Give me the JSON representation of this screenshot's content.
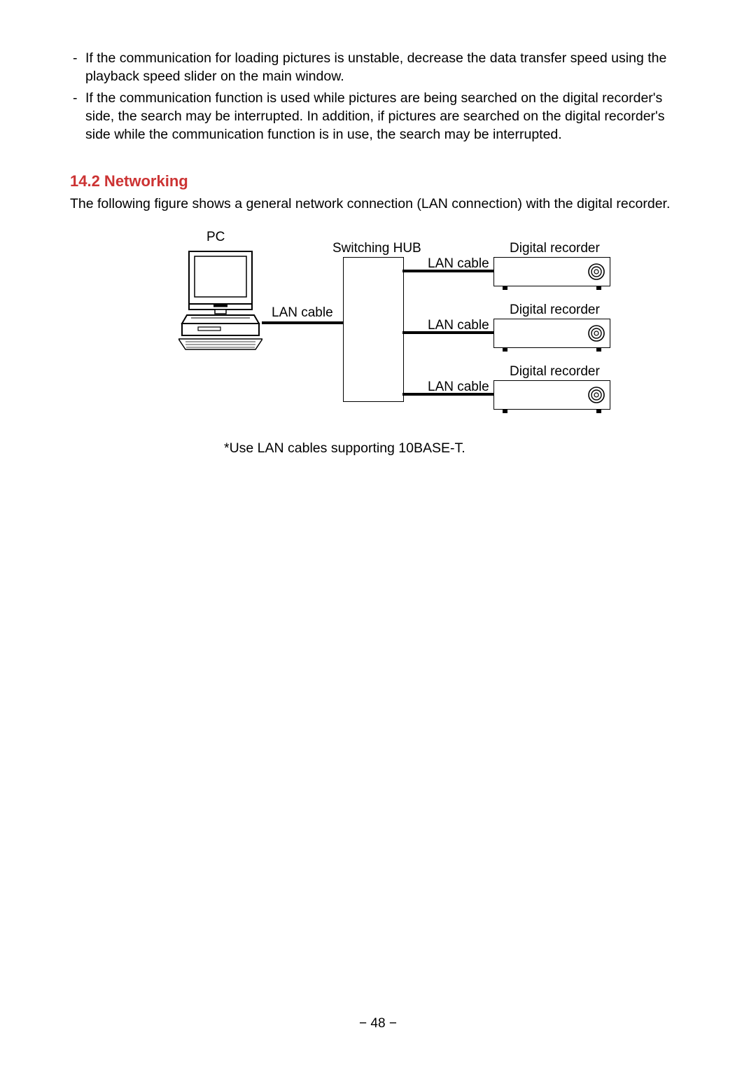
{
  "bullets": [
    "If the communication for loading pictures is unstable, decrease the data transfer speed using the playback speed slider on the main window.",
    "If the communication function is used while pictures are being searched on the digital recorder's side, the search may be interrupted.  In addition, if pictures are searched on the digital recorder's side while the communication function is in use, the search may be interrupted."
  ],
  "heading": "14.2 Networking",
  "intro": "The following figure shows a general network connection (LAN connection) with the digital recorder.",
  "diagram": {
    "pc": "PC",
    "hub": "Switching HUB",
    "cable": "LAN cable",
    "recorder": "Digital recorder",
    "footnote": "*Use LAN cables supporting 10BASE-T."
  },
  "pageNumber": "− 48 −"
}
